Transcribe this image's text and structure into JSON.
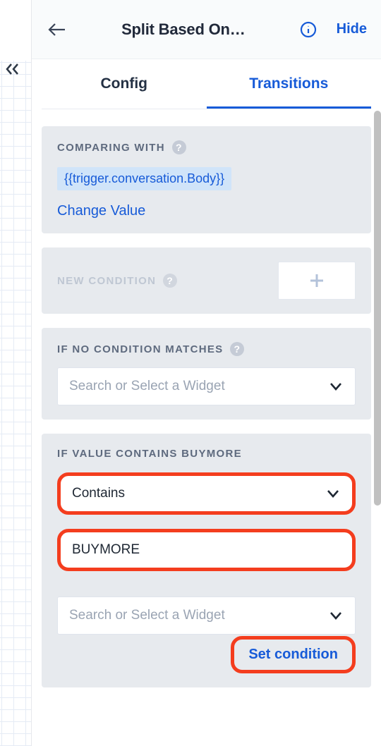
{
  "header": {
    "title": "Split Based On…",
    "hide_label": "Hide"
  },
  "tabs": {
    "config_label": "Config",
    "transitions_label": "Transitions"
  },
  "comparing_with": {
    "heading": "COMPARING WITH",
    "help_symbol": "?",
    "value_chip": "{{trigger.conversation.Body}}",
    "change_value_label": "Change Value"
  },
  "new_condition": {
    "heading": "NEW CONDITION",
    "help_symbol": "?"
  },
  "if_no_match": {
    "heading": "IF NO CONDITION MATCHES",
    "help_symbol": "?",
    "placeholder": "Search or Select a Widget"
  },
  "value_contains": {
    "heading": "IF VALUE CONTAINS BUYMORE",
    "operator_value": "Contains",
    "match_value": "BUYMORE",
    "widget_placeholder": "Search or Select a Widget",
    "set_button_label": "Set condition"
  }
}
